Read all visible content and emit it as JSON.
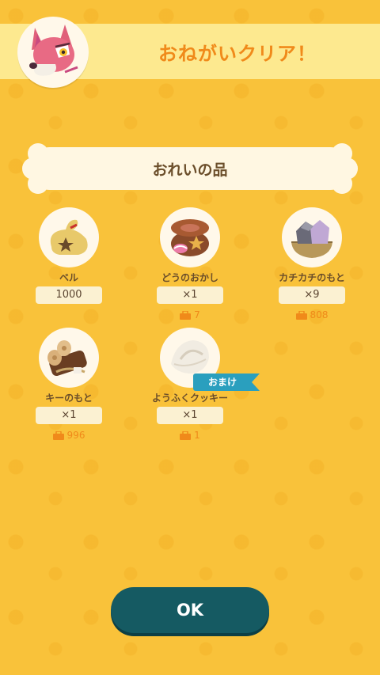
{
  "header": {
    "title": "おねがいクリア！"
  },
  "section": {
    "title": "おれいの品"
  },
  "items": [
    {
      "name": "ベル",
      "qty": "1000",
      "stock": ""
    },
    {
      "name": "どうのおかし",
      "qty": "×1",
      "stock": "7"
    },
    {
      "name": "カチカチのもと",
      "qty": "×9",
      "stock": "808"
    },
    {
      "name": "キーのもと",
      "qty": "×1",
      "stock": "996"
    },
    {
      "name": "ようふくクッキー",
      "qty": "×1",
      "stock": "1",
      "badge": "おまけ"
    }
  ],
  "button": {
    "ok_label": "OK"
  },
  "colors": {
    "background": "#f9c23a",
    "accent": "#f08a1a",
    "button": "#155a62",
    "badge": "#2a9fbe"
  }
}
